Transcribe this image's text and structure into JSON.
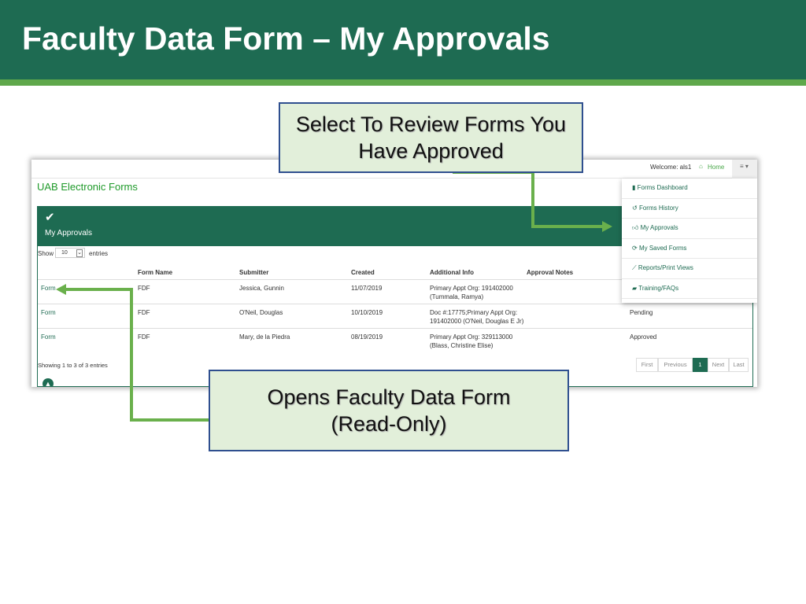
{
  "slide": {
    "title": "Faculty Data Form – My Approvals"
  },
  "app": {
    "welcome": "Welcome: als1",
    "home": "Home",
    "brand": "UAB Electronic Forms",
    "panel_title": "My Approvals",
    "show": "Show",
    "entries_value": "10",
    "entries": "entries",
    "columns": [
      "Form Name",
      "Submitter",
      "Created",
      "Additional Info",
      "Approval Notes"
    ],
    "rows": [
      {
        "link": "Form",
        "form_name": "FDF",
        "submitter": "Jessica, Gunnin",
        "created": "11/07/2019",
        "info1": "Primary Appt Org: 191402000",
        "info2": "(Tummala, Ramya)",
        "status": ""
      },
      {
        "link": "Form",
        "form_name": "FDF",
        "submitter": "O'Neil, Douglas",
        "created": "10/10/2019",
        "info1": "Doc #:17775;Primary Appt Org:",
        "info2": "191402000 (O'Neil, Douglas E Jr)",
        "status": "Pending"
      },
      {
        "link": "Form",
        "form_name": "FDF",
        "submitter": "Mary, de la Piedra",
        "created": "08/19/2019",
        "info1": "Primary Appt Org: 329113000",
        "info2": "(Blass, Christine Elise)",
        "status": "Approved"
      }
    ],
    "showing": "Showing 1 to 3 of 3 entries",
    "pagination": [
      "First",
      "Previous",
      "1",
      "Next",
      "Last"
    ],
    "menu": [
      {
        "label": "Forms Dashboard",
        "icon": "file-icon"
      },
      {
        "label": "Forms History",
        "icon": "history-icon"
      },
      {
        "label": "My Approvals",
        "icon": "thumbs-up-icon"
      },
      {
        "label": "My Saved Forms",
        "icon": "refresh-icon"
      },
      {
        "label": "Reports/Print Views",
        "icon": "chart-icon"
      },
      {
        "label": "Training/FAQs",
        "icon": "book-icon"
      }
    ]
  },
  "callouts": {
    "top": "Select To Review Forms You Have Approved",
    "bottom_line1": "Opens Faculty Data Form",
    "bottom_line2": "(Read-Only)"
  },
  "colors": {
    "brand_green": "#1e6b52",
    "arrow": "#6ab04c",
    "callout_fill": "#e2efda",
    "callout_border": "#2f4f8f"
  }
}
